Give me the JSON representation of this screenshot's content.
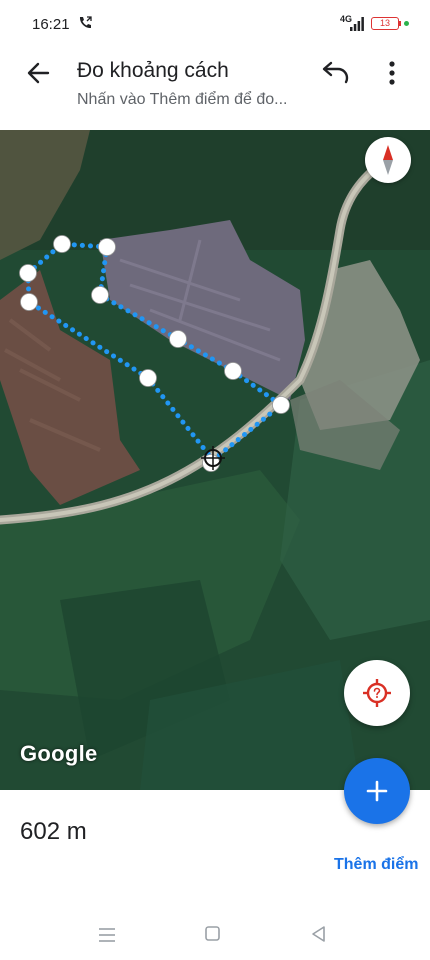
{
  "status_bar": {
    "time": "16:21",
    "network": "4G",
    "battery": "13",
    "icons": [
      "phone-call-icon",
      "signal-icon",
      "battery-icon"
    ]
  },
  "app_bar": {
    "title": "Đo khoảng cách",
    "subtitle": "Nhấn vào Thêm điểm để đo...",
    "icons": [
      "back-arrow-icon",
      "undo-icon",
      "more-vert-icon"
    ]
  },
  "map": {
    "attribution": "Google",
    "route_color": "#2196f3",
    "icons": [
      "compass-icon",
      "my-location-icon",
      "add-icon"
    ]
  },
  "bottom": {
    "distance": "602 m",
    "add_point_label": "Thêm điểm"
  },
  "nav_bar": {
    "icons": [
      "recent-apps-icon",
      "home-icon",
      "back-icon"
    ]
  },
  "colors": {
    "accent": "#1a73e8",
    "locate_red": "#d93025"
  }
}
